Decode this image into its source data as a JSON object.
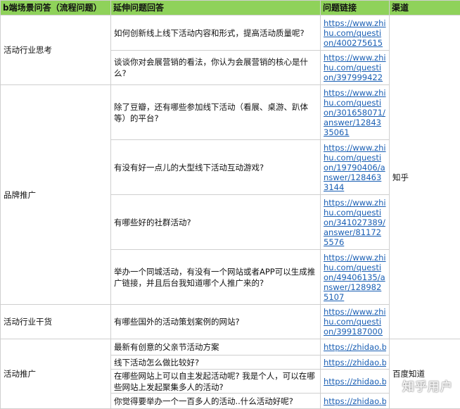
{
  "header": {
    "col1": "b端场景问答（流程问题）",
    "col2": "延伸问题回答",
    "col3": "问题链接",
    "col4": "渠道"
  },
  "categories": {
    "c1": "活动行业思考",
    "c2": "品牌推广",
    "c3": "活动行业干货",
    "c4": "活动推广"
  },
  "channels": {
    "zhihu": "知乎",
    "baidu": "百度知道"
  },
  "rows": [
    {
      "question": "如何创新线上线下活动内容和形式，提高活动质量呢?",
      "link": "https://www.zhihu.com/question/400275615"
    },
    {
      "question": "谈谈你对会展营销的看法，你认为会展营销的核心是什么?",
      "link": "https://www.zhihu.com/question/397999422"
    },
    {
      "question": " 除了豆瓣，还有哪些参加线下活动（看展、桌游、趴体等）的平台?",
      "link": "https://www.zhihu.com/question/301658071/answer/1284335061"
    },
    {
      "question": "有没有好一点儿的大型线下活动互动游戏?",
      "link": "https://www.zhihu.com/question/19790406/answer/1284633144"
    },
    {
      "question": "有哪些好的社群活动?",
      "link": "https://www.zhihu.com/question/341027389/answer/811725576"
    },
    {
      "question": "举办一个同城活动，有没有一个网站或者APP可以生成推广链接，并且后台我知道哪个人推广来的?",
      "link": "https://www.zhihu.com/question/49406135/answer/1289825107"
    },
    {
      "question": "有哪些国外的活动策划案例的网站?",
      "link": "https://www.zhihu.com/question/399187000"
    },
    {
      "question": "最新有创意的父亲节活动方案",
      "link": "https://zhidao.ba"
    },
    {
      "question": "线下活动怎么做比较好?",
      "link": "https://zhidao.ba"
    },
    {
      "question": "在哪些网站上可以自主发起活动呢? 我是个人，可以在哪些网站上发起聚集多人的活动?",
      "link": "https://zhidao.ba"
    },
    {
      "question": "你觉得要举办一个一百多人的活动..什么活动好呢?",
      "link": "https://zhidao.ba"
    }
  ],
  "watermark": "知乎用户"
}
